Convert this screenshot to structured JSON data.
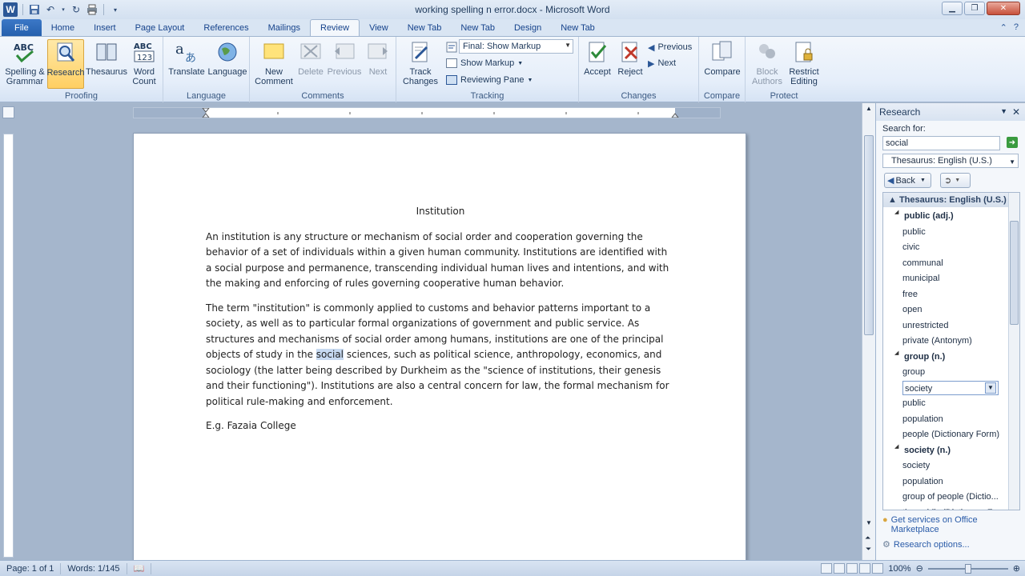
{
  "window": {
    "title": "working spelling n error.docx - Microsoft Word"
  },
  "tabs": [
    "File",
    "Home",
    "Insert",
    "Page Layout",
    "References",
    "Mailings",
    "Review",
    "View",
    "New Tab",
    "New Tab",
    "Design",
    "New Tab"
  ],
  "active_tab": "Review",
  "ribbon": {
    "proofing": {
      "label": "Proofing",
      "spelling": "Spelling &",
      "spelling2": "Grammar",
      "research": "Research",
      "thesaurus": "Thesaurus",
      "wordcount": "Word",
      "wordcount2": "Count"
    },
    "language": {
      "label": "Language",
      "translate": "Translate",
      "language": "Language"
    },
    "comments": {
      "label": "Comments",
      "new": "New",
      "new2": "Comment",
      "delete": "Delete",
      "previous": "Previous",
      "next": "Next"
    },
    "tracking": {
      "label": "Tracking",
      "track": "Track",
      "track2": "Changes",
      "markup_dd": "Final: Show Markup",
      "show_markup": "Show Markup",
      "reviewing_pane": "Reviewing Pane"
    },
    "changes": {
      "label": "Changes",
      "accept": "Accept",
      "reject": "Reject",
      "previous": "Previous",
      "next": "Next"
    },
    "compare": {
      "label": "Compare",
      "compare": "Compare"
    },
    "protect": {
      "label": "Protect",
      "block": "Block",
      "block2": "Authors",
      "restrict": "Restrict",
      "restrict2": "Editing"
    }
  },
  "document": {
    "title": "Institution",
    "p1": "An institution is any structure or mechanism of social order and cooperation governing the behavior of a set of individuals within a given human community. Institutions are identified with a social purpose and permanence, transcending individual human lives and intentions, and with the making and enforcing of rules governing cooperative human behavior.",
    "p2_before": "The term \"institution\" is commonly applied to customs and behavior patterns important to a society, as well as to particular formal organizations of government and public service. As structures and mechanisms of social order among humans, institutions are one of the principal objects of study in the ",
    "p2_highlight": "social",
    "p2_after": " sciences, such as political science, anthropology, economics, and sociology (the latter being described by Durkheim as the \"science of institutions, their genesis and their functioning\").  Institutions are also a central concern for law, the formal mechanism for political rule-making and enforcement.",
    "p3": "E.g. Fazaia College"
  },
  "research_pane": {
    "title": "Research",
    "search_label": "Search for:",
    "search_value": "social",
    "source": "Thesaurus: English (U.S.)",
    "back": "Back",
    "results_header": "Thesaurus: English (U.S.)",
    "results": [
      {
        "text": "public (adj.)",
        "cat": true
      },
      {
        "text": "public"
      },
      {
        "text": "civic"
      },
      {
        "text": "communal"
      },
      {
        "text": "municipal"
      },
      {
        "text": "free"
      },
      {
        "text": "open"
      },
      {
        "text": "unrestricted"
      },
      {
        "text": "private (Antonym)"
      },
      {
        "text": "group (n.)",
        "cat": true
      },
      {
        "text": "group"
      },
      {
        "text": "society",
        "selected": true
      },
      {
        "text": "public"
      },
      {
        "text": "population"
      },
      {
        "text": "people (Dictionary Form)"
      },
      {
        "text": "society (n.)",
        "cat": true
      },
      {
        "text": "society"
      },
      {
        "text": "population"
      },
      {
        "text": "group of people (Dictio..."
      },
      {
        "text": "the public (Dictionary F..."
      }
    ],
    "link1a": "Get services on Office",
    "link1b": "Marketplace",
    "link2": "Research options..."
  },
  "status": {
    "page": "Page: 1 of 1",
    "words": "Words: 1/145",
    "zoom": "100%"
  }
}
